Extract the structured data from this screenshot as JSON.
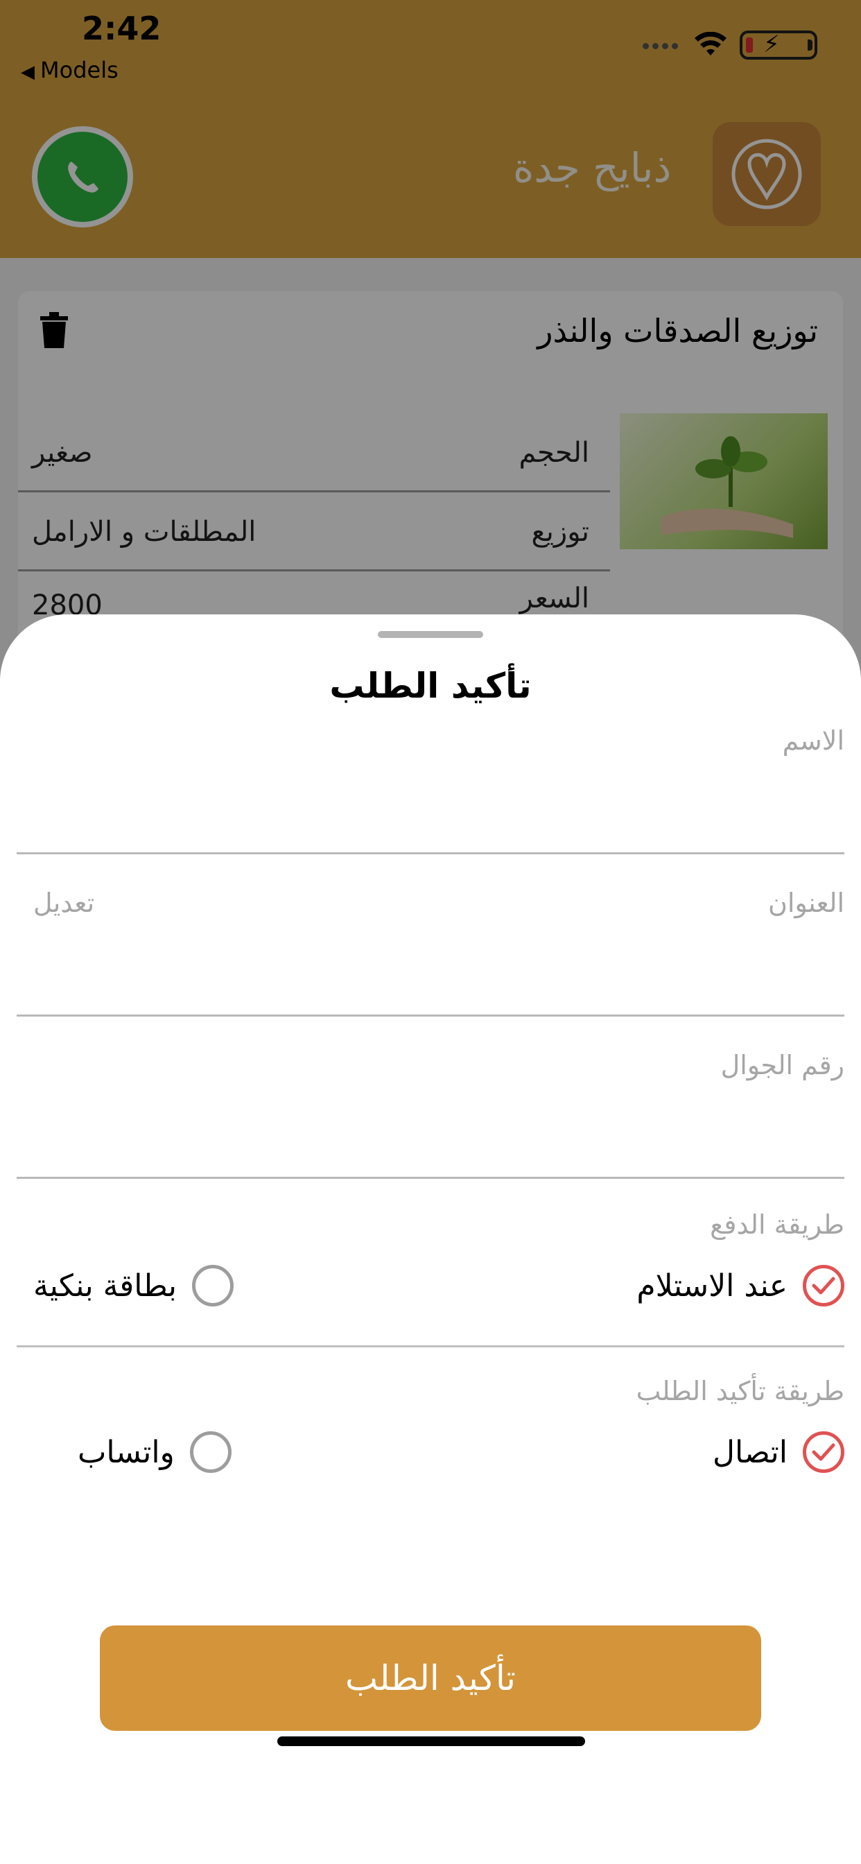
{
  "status_bar": {
    "time": "2:42",
    "back_label": "Models"
  },
  "header": {
    "app_name": "ذبايح جدة"
  },
  "cart_item": {
    "title": "توزيع الصدقات والنذر",
    "rows": [
      {
        "key": "الحجم",
        "value": "صغير"
      },
      {
        "key": "توزيع",
        "value": "المطلقات و الارامل"
      },
      {
        "key": "السعر",
        "value": "2800"
      }
    ]
  },
  "sheet": {
    "title": "تأكيد الطلب",
    "name_label": "الاسم",
    "address_label": "العنوان",
    "edit_label": "تعديل",
    "phone_label": "رقم الجوال",
    "payment_label": "طريقة الدفع",
    "payment_options": [
      {
        "label": "عند الاستلام",
        "checked": true
      },
      {
        "label": "بطاقة بنكية",
        "checked": false
      }
    ],
    "confirm_method_label": "طريقة تأكيد الطلب",
    "confirm_method_options": [
      {
        "label": "اتصال",
        "checked": true
      },
      {
        "label": "واتساب",
        "checked": false
      }
    ],
    "confirm_button": "تأكيد الطلب"
  },
  "colors": {
    "header": "#d8a441",
    "accent_button": "#d3943a",
    "check": "#e05252",
    "whatsapp": "#2db742"
  }
}
